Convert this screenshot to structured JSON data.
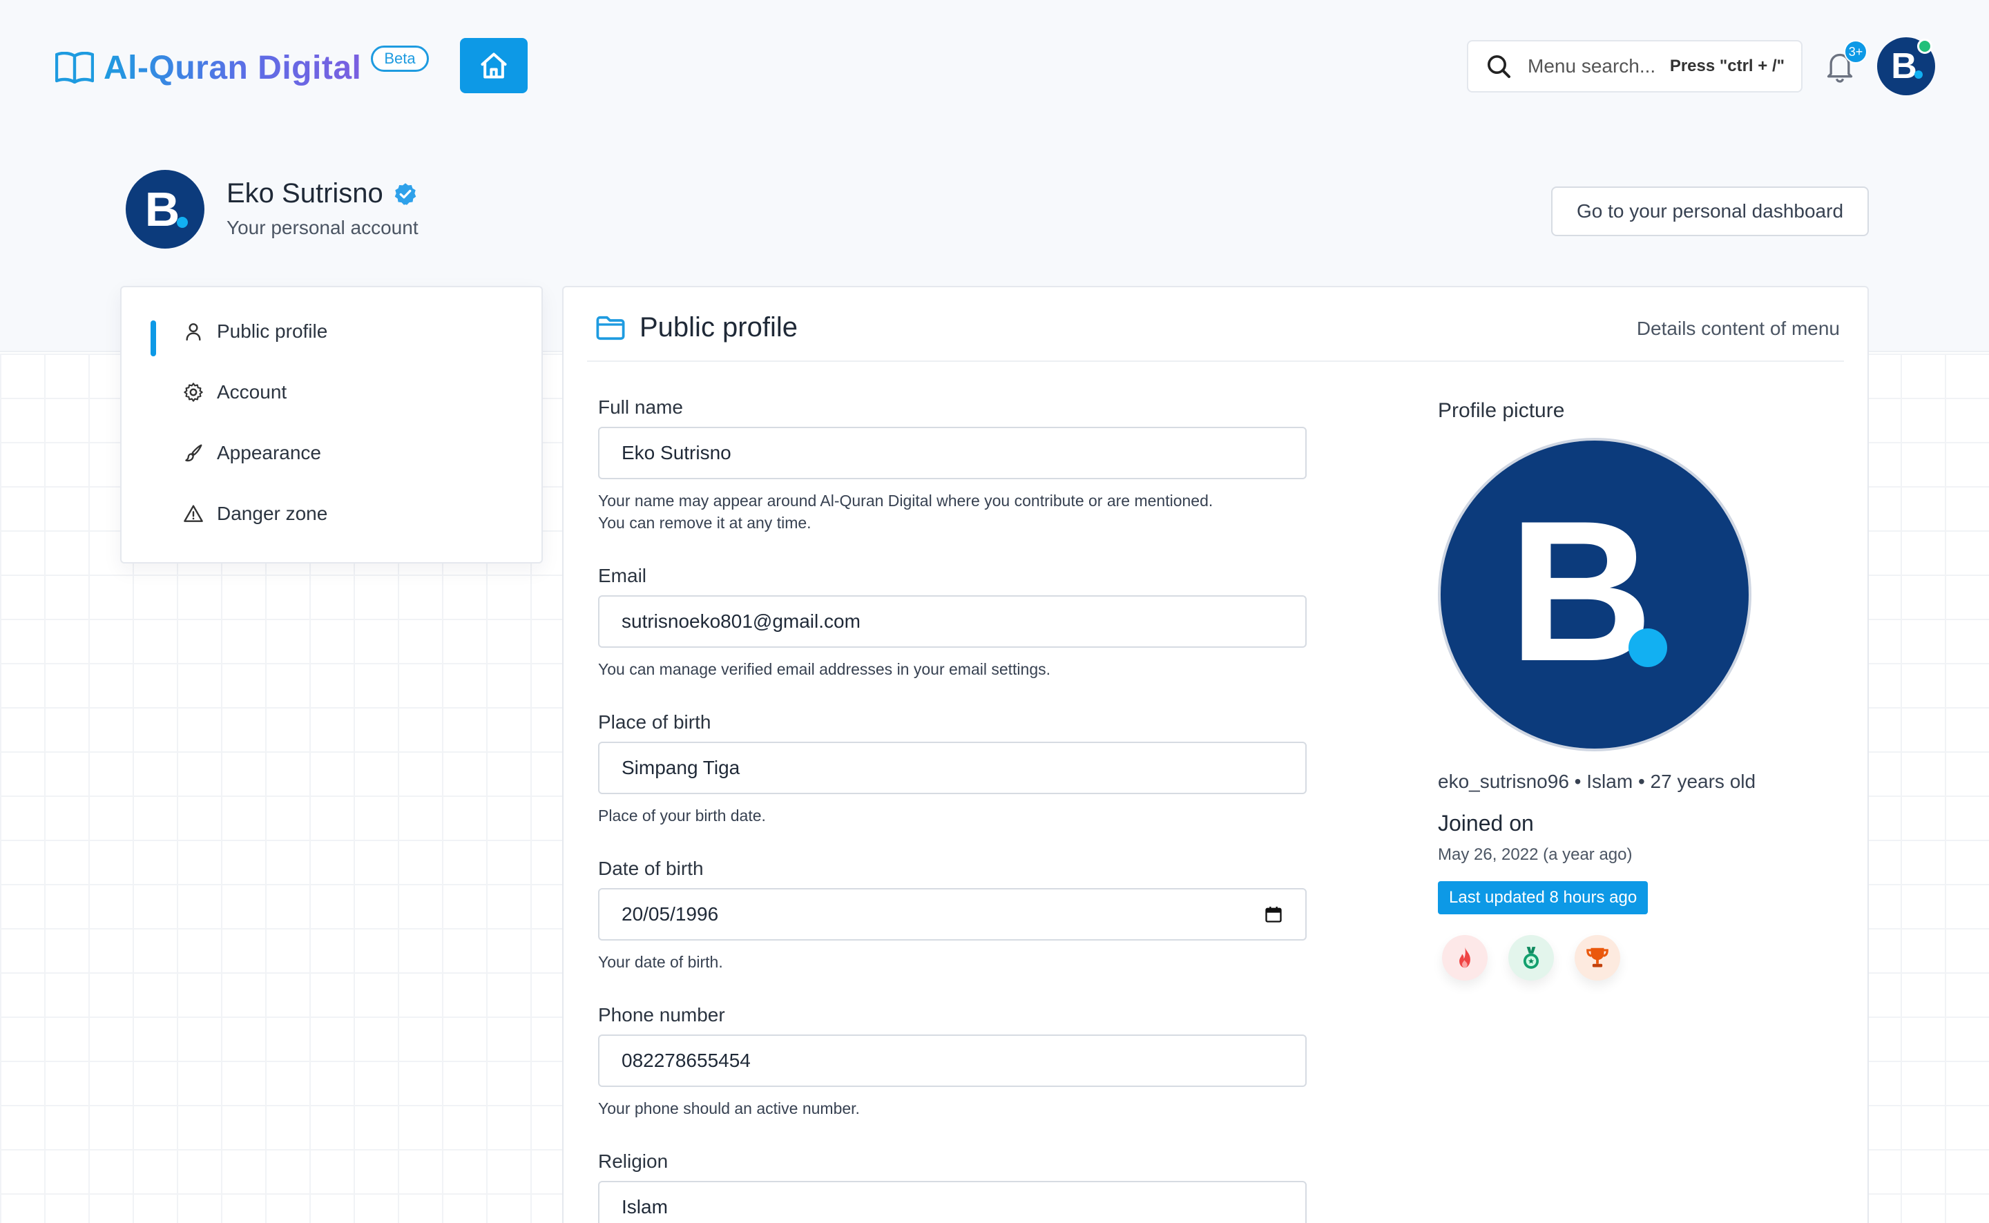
{
  "header": {
    "brand_name": "Al-Quran Digital",
    "beta_label": "Beta",
    "search_placeholder": "Menu search...",
    "search_hint": "Press \"ctrl + /\"",
    "notification_count": "3+",
    "avatar_letter": "B"
  },
  "profile_header": {
    "name": "Eko Sutrisno",
    "subtitle": "Your personal account",
    "dashboard_button": "Go to your personal dashboard"
  },
  "sidebar": {
    "items": [
      {
        "label": "Public profile",
        "icon": "user-icon",
        "active": true
      },
      {
        "label": "Account",
        "icon": "gear-icon",
        "active": false
      },
      {
        "label": "Appearance",
        "icon": "brush-icon",
        "active": false
      },
      {
        "label": "Danger zone",
        "icon": "warning-icon",
        "active": false
      }
    ]
  },
  "main": {
    "title": "Public profile",
    "right_text": "Details content of menu",
    "fields": [
      {
        "label": "Full name",
        "value": "Eko Sutrisno",
        "help": "Your name may appear around Al-Quran Digital where you contribute or are mentioned.",
        "help2": "You can remove it at any time."
      },
      {
        "label": "Email",
        "value": "sutrisnoeko801@gmail.com",
        "help": "You can manage verified email addresses in your email settings."
      },
      {
        "label": "Place of birth",
        "value": "Simpang Tiga",
        "help": "Place of your birth date."
      },
      {
        "label": "Date of birth",
        "value": "20/05/1996",
        "help": "Your date of birth."
      },
      {
        "label": "Phone number",
        "value": "082278655454",
        "help": "Your phone should an active number."
      },
      {
        "label": "Religion",
        "value": "Islam"
      }
    ]
  },
  "profile_side": {
    "picture_label": "Profile picture",
    "avatar_letter": "B",
    "meta": "eko_sutrisno96 • Islam • 27 years old",
    "joined_title": "Joined on",
    "joined_date": "May 26, 2022 (a year ago)",
    "updated": "Last updated 8 hours ago",
    "achievements": [
      "fire-icon",
      "medal-icon",
      "trophy-icon"
    ]
  },
  "colors": {
    "accent": "#0d99e6",
    "avatar_bg": "#0c3b7c",
    "online": "#22c07a"
  }
}
